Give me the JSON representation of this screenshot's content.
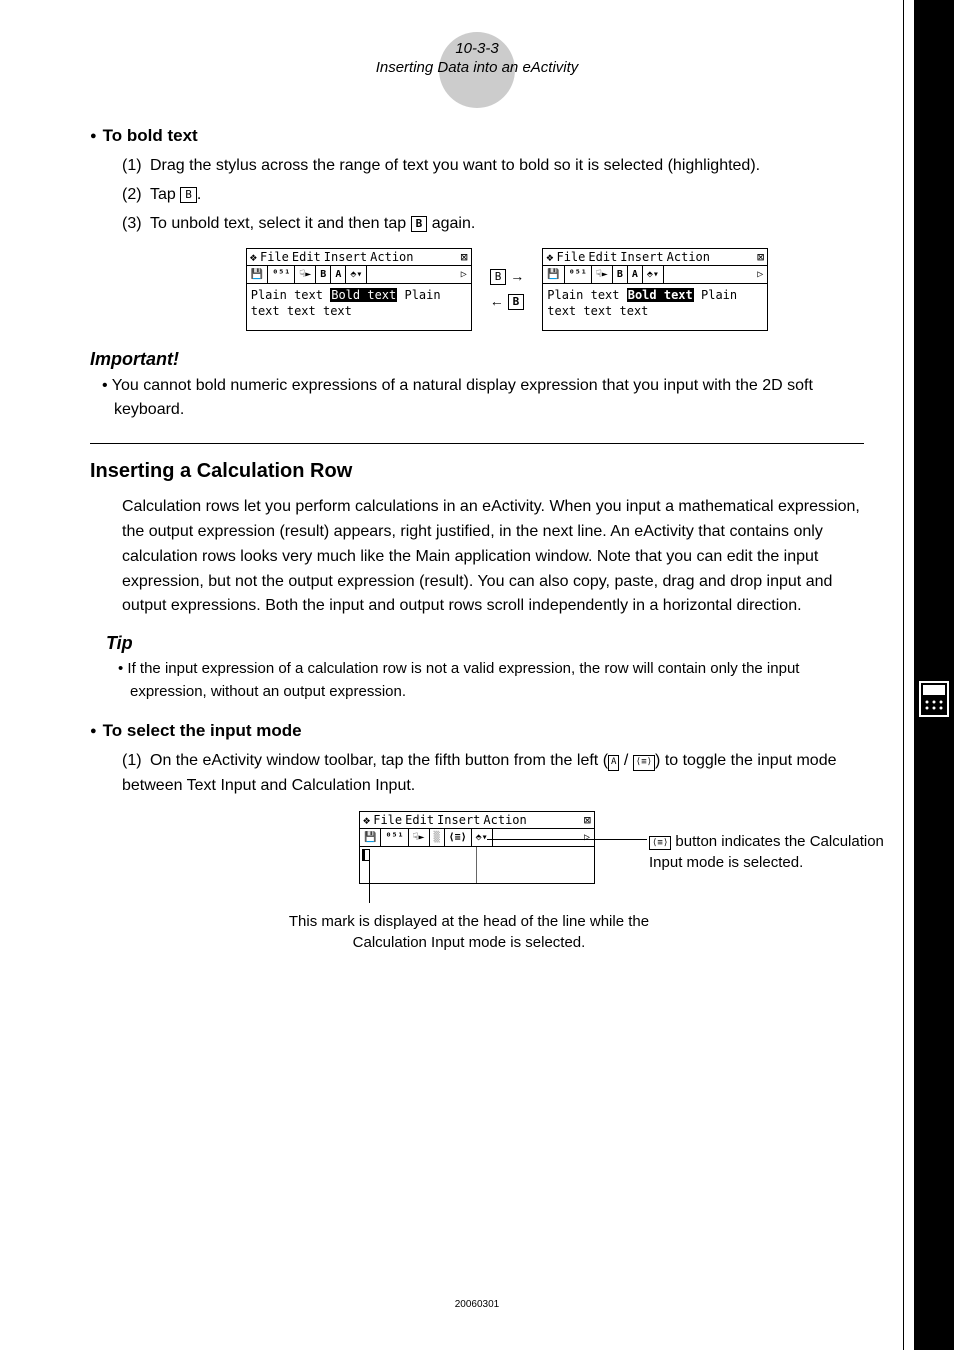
{
  "header": {
    "number": "10-3-3",
    "title": "Inserting Data into an eActivity"
  },
  "sections": {
    "boldText": {
      "heading": "To bold text",
      "steps": [
        "Drag the stylus across the range of text you want to bold so it is selected (highlighted).",
        "Tap ",
        "To unbold text, select it and then tap "
      ],
      "step2_suffix": ".",
      "step3_suffix": " again.",
      "btn_b_thin": "B",
      "btn_b_bold": "B"
    },
    "screenshot1": {
      "menu": [
        "File",
        "Edit",
        "Insert",
        "Action"
      ],
      "body_plain": "Plain text ",
      "body_bold_sel": "Bold text",
      "body_after": " Plain text text text",
      "arrow_right": "→",
      "arrow_left": "←"
    },
    "important": {
      "heading": "Important!",
      "text": "You cannot bold numeric expressions of a natural display expression that you input with the 2D soft keyboard."
    },
    "calcRow": {
      "heading": "Inserting a Calculation Row",
      "para": "Calculation rows let you perform calculations in an eActivity. When you input a mathematical expression, the output expression (result) appears, right justified, in the next line. An eActivity that contains only calculation rows looks very much like the Main application window. Note that you can edit the input expression, but not the output expression (result). You can also copy, paste, drag and drop input and output expressions. Both the input and output rows scroll independently in a horizontal direction."
    },
    "tip": {
      "heading": "Tip",
      "text": "If the input expression of a calculation row is not a valid expression, the row will contain only the input expression, without an output expression."
    },
    "selectInput": {
      "heading": "To select the input mode",
      "step1_pre": "On the eActivity window toolbar, tap the fifth button from the left (",
      "step1_mid": " / ",
      "step1_post": ") to toggle the input mode between Text Input and Calculation Input.",
      "icon_a": "A",
      "icon_calc": "⟨≡⟩"
    },
    "annotations": {
      "right_btn": "⟨≡⟩",
      "right_text": " button indicates the Calculation Input mode is selected.",
      "bottom": "This mark is displayed at the head of the line while the Calculation Input mode is selected."
    }
  },
  "footer": "20060301"
}
